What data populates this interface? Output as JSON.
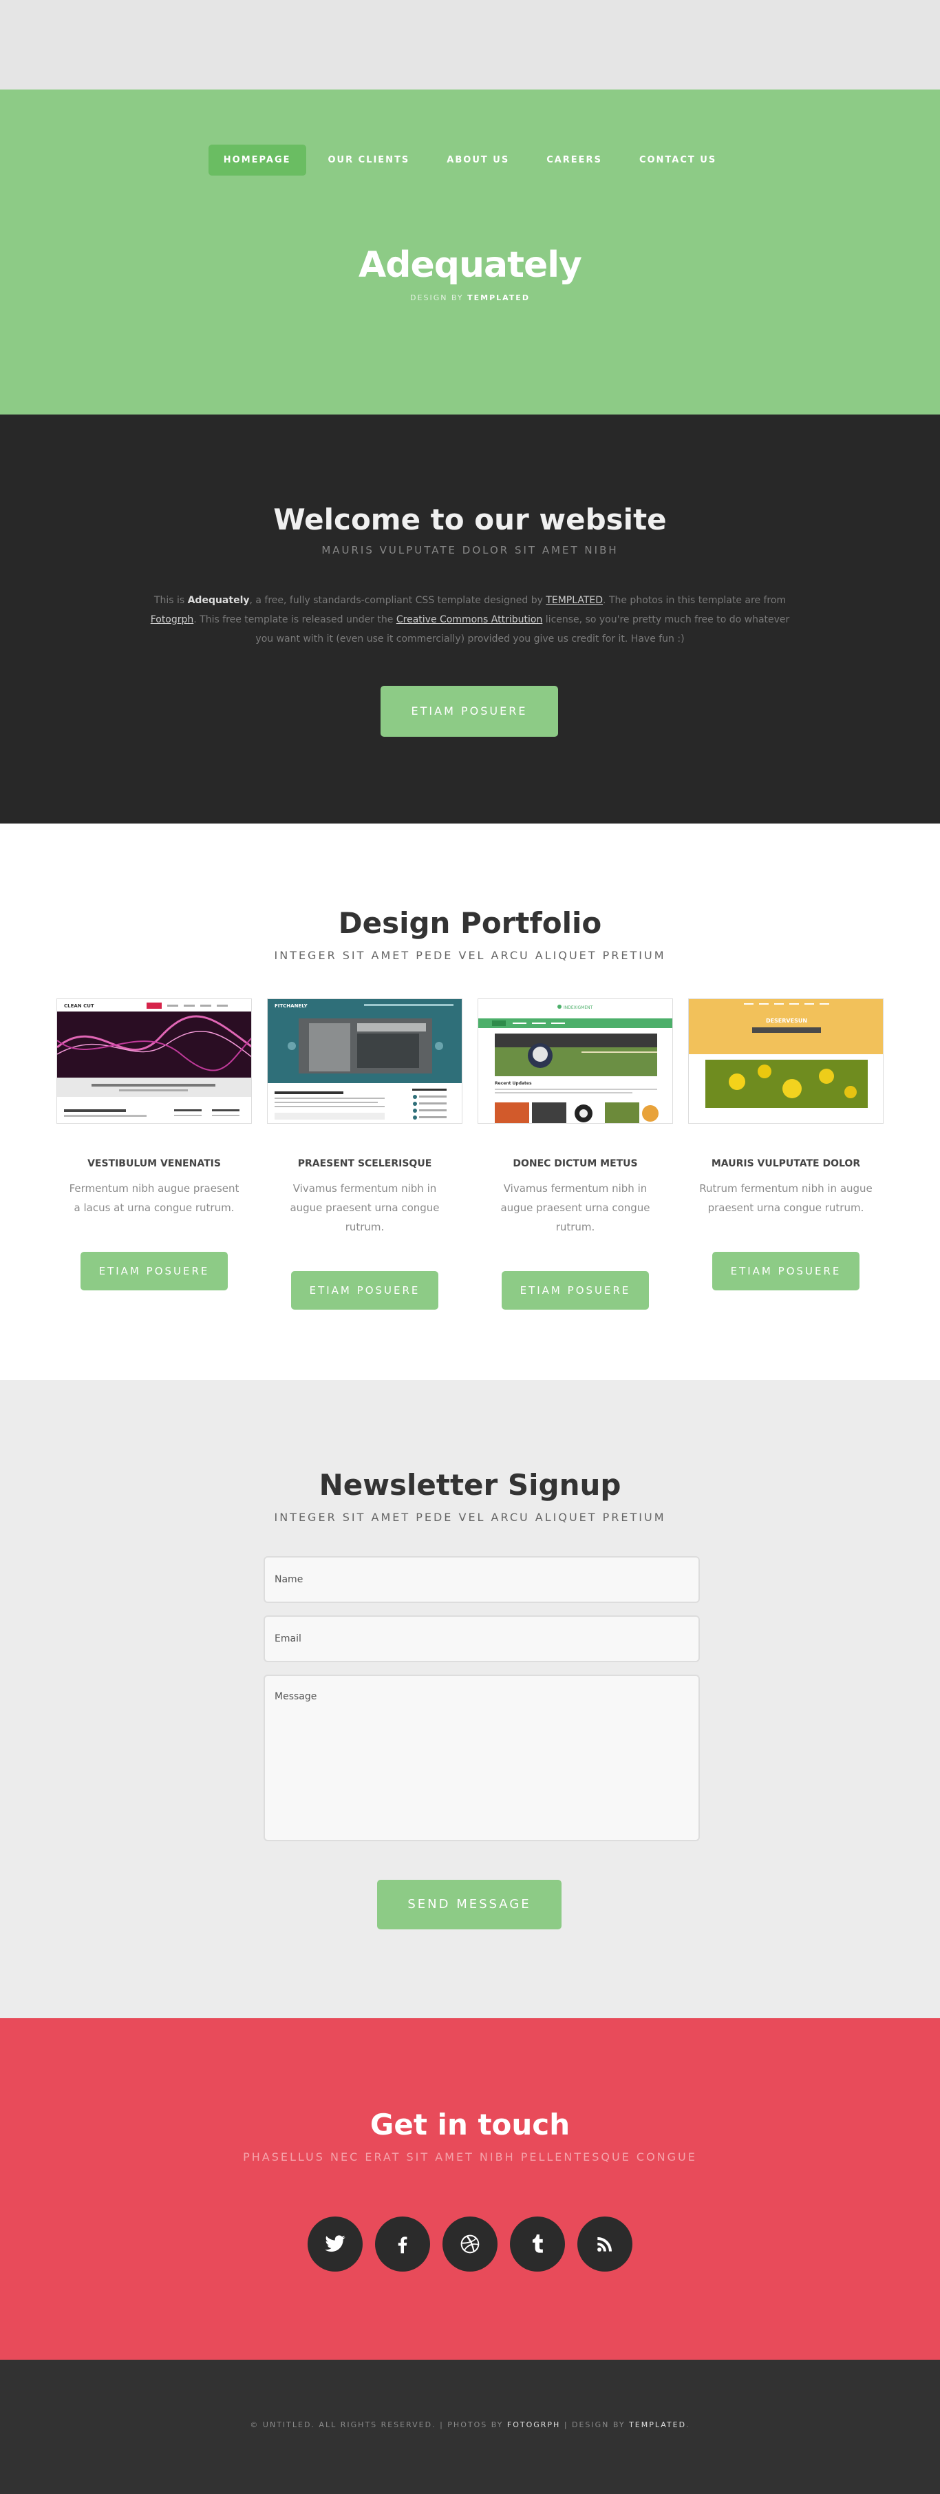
{
  "nav": {
    "items": [
      {
        "label": "HOMEPAGE",
        "active": true
      },
      {
        "label": "OUR CLIENTS"
      },
      {
        "label": "ABOUT US"
      },
      {
        "label": "CAREERS"
      },
      {
        "label": "CONTACT US"
      }
    ]
  },
  "header": {
    "title": "Adequately",
    "byline_prefix": "DESIGN BY",
    "byline_brand": "TEMPLATED"
  },
  "welcome": {
    "title": "Welcome to our website",
    "subtitle": "MAURIS VULPUTATE DOLOR SIT AMET NIBH",
    "p_this_is": "This is",
    "p_brand": "Adequately",
    "p_part1": ", a free, fully standards-compliant CSS template designed by",
    "p_link1": "TEMPLATED",
    "p_part2": ". The photos in this template are from",
    "p_link2": "Fotogrph",
    "p_part3": ". This free template is released under the",
    "p_link3": "Creative Commons Attribution",
    "p_part4": "license, so you're pretty much free to do whatever you want with it (even use it commercially) provided you give us credit for it. Have fun :)",
    "button": "ETIAM POSUERE"
  },
  "portfolio": {
    "title": "Design Portfolio",
    "subtitle": "INTEGER SIT AMET PEDE VEL ARCU ALIQUET PRETIUM",
    "cards": [
      {
        "title": "VESTIBULUM VENENATIS",
        "text": "Fermentum nibh augue praesent a lacus at urna congue rutrum.",
        "button": "ETIAM POSUERE",
        "thumb_brand": "CLEAN CUT",
        "thumb_heading": "Welcome to our website"
      },
      {
        "title": "PRAESENT SCELERISQUE",
        "text": "Vivamus fermentum nibh in augue praesent urna congue rutrum.",
        "button": "ETIAM POSUERE",
        "thumb_brand": "FITCHANELY",
        "thumb_heading": "Welcome to our website"
      },
      {
        "title": "DONEC DICTUM METUS",
        "text": "Vivamus fermentum nibh in augue praesent urna congue rutrum.",
        "button": "ETIAM POSUERE",
        "thumb_brand": "INDEXIGMENT",
        "thumb_heading": "Recent Updates"
      },
      {
        "title": "MAURIS VULPUTATE DOLOR",
        "text": "Rutrum fermentum nibh in augue praesent urna congue rutrum.",
        "button": "ETIAM POSUERE",
        "thumb_brand": "DESERVESUN",
        "thumb_heading": ""
      }
    ]
  },
  "newsletter": {
    "title": "Newsletter Signup",
    "subtitle": "INTEGER SIT AMET PEDE VEL ARCU ALIQUET PRETIUM",
    "name_placeholder": "Name",
    "email_placeholder": "Email",
    "message_placeholder": "Message",
    "button": "SEND MESSAGE"
  },
  "contact": {
    "title": "Get in touch",
    "subtitle": "PHASELLUS NEC ERAT SIT AMET NIBH PELLENTESQUE CONGUE",
    "socials": [
      "twitter-icon",
      "facebook-icon",
      "dribbble-icon",
      "tumblr-icon",
      "rss-icon"
    ]
  },
  "footer": {
    "copy_prefix": "© UNTITLED. ALL RIGHTS RESERVED. | PHOTOS BY",
    "photos_by": "FOTOGRPH",
    "design_by_label": "| DESIGN BY",
    "design_by": "TEMPLATED",
    "suffix": "."
  },
  "colors": {
    "green": "#8dcb86",
    "green_active": "#6abd62",
    "dark": "#282828",
    "red": "#e84b5a",
    "footer": "#323232"
  }
}
